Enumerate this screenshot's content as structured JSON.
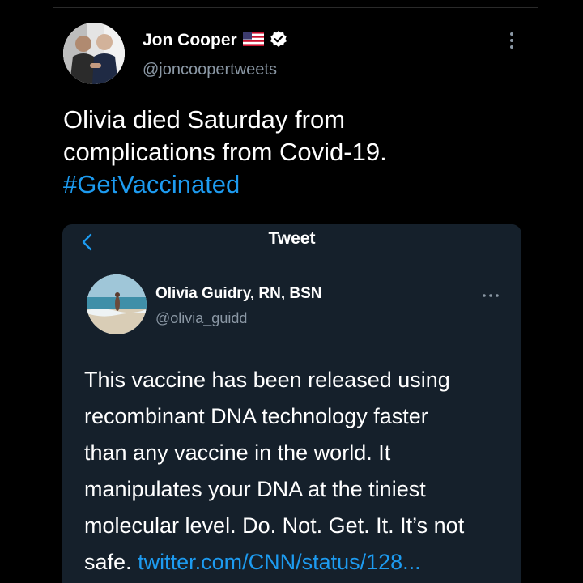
{
  "outer_tweet": {
    "author_name": "Jon Cooper",
    "author_handle": "@joncoopertweets",
    "text_lines": [
      "Olivia died Saturday from",
      "complications from Covid-19."
    ],
    "hashtag": "#GetVaccinated"
  },
  "embedded_card": {
    "title": "Tweet",
    "author_name": "Olivia Guidry, RN, BSN",
    "author_handle": "@olivia_guidd",
    "text_lines": [
      "This vaccine has been released using",
      "recombinant DNA technology faster",
      "than any vaccine in the world. It",
      "manipulates your DNA at the tiniest",
      "molecular level. Do. Not. Get. It. It’s not"
    ],
    "last_line_text": "safe.",
    "link_text": "twitter.com/CNN/status/128..."
  },
  "icons": {
    "flag": "us-flag-icon",
    "verified": "verified-badge-icon",
    "outer_more": "more-vertical-icon",
    "back": "back-chevron-icon",
    "inner_more": "more-horizontal-icon"
  },
  "colors": {
    "background": "#000000",
    "card_background": "#15202b",
    "accent": "#1d9bf0",
    "secondary_text": "#8b98a5"
  }
}
